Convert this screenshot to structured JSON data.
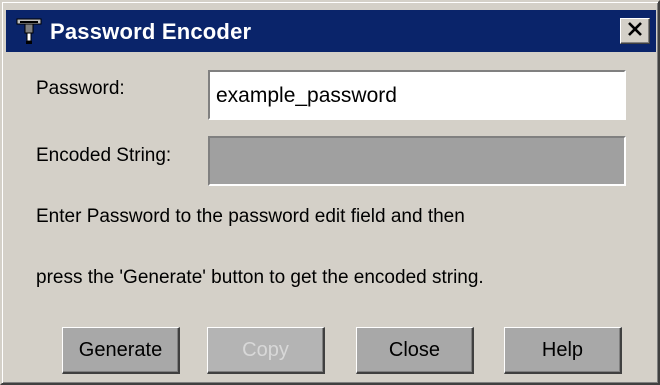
{
  "window": {
    "title": "Password Encoder",
    "close_icon": "close-x-icon",
    "app_icon": "encoder-app-icon",
    "titlebar_color": "#0a246a",
    "face_color": "#d4d0c8"
  },
  "form": {
    "password_label": "Password:",
    "password_value": "example_password",
    "encoded_label": "Encoded String:",
    "encoded_value": ""
  },
  "instructions": {
    "line1": "Enter Password to the password edit field and then",
    "line2": "press the 'Generate' button to get the encoded string."
  },
  "buttons": {
    "generate": "Generate",
    "copy": "Copy",
    "close": "Close",
    "help": "Help"
  }
}
